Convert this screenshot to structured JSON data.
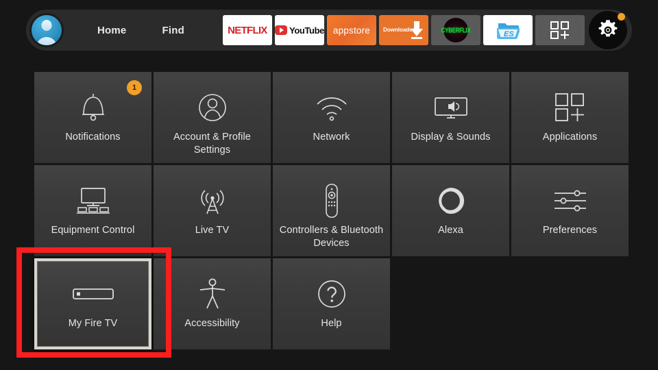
{
  "topbar": {
    "avatar_name": "profile-avatar",
    "nav": [
      {
        "label": "Home",
        "name": "nav-home"
      },
      {
        "label": "Find",
        "name": "nav-find"
      }
    ],
    "apps": [
      {
        "label": "NETFLIX",
        "name": "app-netflix"
      },
      {
        "label": "YouTube",
        "name": "app-youtube"
      },
      {
        "label": "appstore",
        "name": "app-appstore"
      },
      {
        "label": "Downloader",
        "name": "app-downloader"
      },
      {
        "label": "CYBERFLIX",
        "name": "app-cyberflix"
      },
      {
        "label": "ES File Explorer",
        "name": "app-es-file-explorer"
      },
      {
        "label": "Apps Grid",
        "name": "app-grid-more"
      }
    ],
    "settings_button_label": "Settings",
    "settings_has_notification_dot": true
  },
  "grid": {
    "tiles": [
      {
        "label": "Notifications",
        "icon": "bell-icon",
        "badge": "1",
        "focused": false
      },
      {
        "label": "Account & Profile Settings",
        "icon": "person-icon",
        "badge": null,
        "focused": false
      },
      {
        "label": "Network",
        "icon": "wifi-icon",
        "badge": null,
        "focused": false
      },
      {
        "label": "Display & Sounds",
        "icon": "tv-sound-icon",
        "badge": null,
        "focused": false
      },
      {
        "label": "Applications",
        "icon": "apps-plus-icon",
        "badge": null,
        "focused": false
      },
      {
        "label": "Equipment Control",
        "icon": "equipment-icon",
        "badge": null,
        "focused": false
      },
      {
        "label": "Live TV",
        "icon": "antenna-icon",
        "badge": null,
        "focused": false
      },
      {
        "label": "Controllers & Bluetooth Devices",
        "icon": "remote-icon",
        "badge": null,
        "focused": false
      },
      {
        "label": "Alexa",
        "icon": "alexa-icon",
        "badge": null,
        "focused": false
      },
      {
        "label": "Preferences",
        "icon": "sliders-icon",
        "badge": null,
        "focused": false
      },
      {
        "label": "My Fire TV",
        "icon": "firestick-icon",
        "badge": null,
        "focused": true
      },
      {
        "label": "Accessibility",
        "icon": "accessibility-icon",
        "badge": null,
        "focused": false
      },
      {
        "label": "Help",
        "icon": "question-icon",
        "badge": null,
        "focused": false
      }
    ]
  },
  "annotation": {
    "name": "red-highlight-box",
    "target": "My Fire TV",
    "color": "#fa1e1e"
  },
  "colors": {
    "background": "#161616",
    "topbar": "#2b2b2b",
    "tile": "#3b3b3b",
    "accent_orange": "#f2a027",
    "focus_border": "#d8d5cd",
    "annotation_red": "#fa1e1e"
  }
}
